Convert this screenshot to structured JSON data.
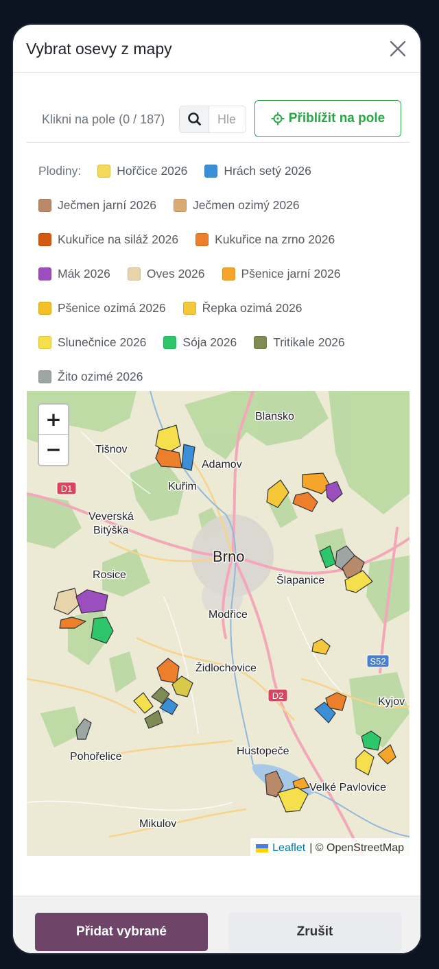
{
  "dialog": {
    "title": "Vybrat osevy z mapy",
    "close_icon": "close-icon"
  },
  "toolbar": {
    "hint": "Klikni na pole (0 / 187)",
    "search_placeholder": "Hle",
    "search_icon": "search-icon",
    "zoom_fields_label": "Přiblížit na pole",
    "zoom_fields_icon": "crosshair-icon"
  },
  "legend": {
    "label": "Plodiny:",
    "rows": [
      [
        {
          "name": "Hořčice 2026",
          "color": "#f5d75a"
        },
        {
          "name": "Hrách setý 2026",
          "color": "#3a8fd6"
        }
      ],
      [
        {
          "name": "Ječmen jarní 2026",
          "color": "#b98a6a"
        },
        {
          "name": "Ječmen ozimý 2026",
          "color": "#d9ab72"
        }
      ],
      [
        {
          "name": "Kukuřice na siláž 2026",
          "color": "#d35a12"
        },
        {
          "name": "Kukuřice na zrno 2026",
          "color": "#ec7f2c"
        }
      ],
      [
        {
          "name": "Mák 2026",
          "color": "#9b4ebd"
        },
        {
          "name": "Oves 2026",
          "color": "#e8d4ab"
        },
        {
          "name": "Pšenice jarní 2026",
          "color": "#f5a529"
        }
      ],
      [
        {
          "name": "Pšenice ozimá 2026",
          "color": "#f2c026"
        },
        {
          "name": "Řepka ozimá 2026",
          "color": "#f5c83a"
        }
      ],
      [
        {
          "name": "Slunečnice 2026",
          "color": "#f6df4c"
        },
        {
          "name": "Sója 2026",
          "color": "#2ec66a"
        },
        {
          "name": "Tritikale 2026",
          "color": "#7f8b55"
        }
      ],
      [
        {
          "name": "Žito ozimé 2026",
          "color": "#9ea6a4"
        }
      ]
    ]
  },
  "map": {
    "zoom_in": "+",
    "zoom_out": "−",
    "attribution_link": "Leaflet",
    "attribution_text": "| © OpenStreetMap",
    "towns": {
      "blansko": "Blansko",
      "tisnov": "Tišnov",
      "adamov": "Adamov",
      "kurim": "Kuřim",
      "veverska1": "Veverská",
      "veverska2": "Bitýška",
      "brno": "Brno",
      "rosice": "Rosice",
      "slapanice": "Šlapanice",
      "modrice": "Modřice",
      "zidlochovice": "Židlochovice",
      "kyjov": "Kyjov",
      "hustopece": "Hustopeče",
      "pohorelice": "Pohořelice",
      "velke_pavlovice": "Velké Pavlovice",
      "mikulov": "Mikulov"
    },
    "road_labels": {
      "d1": "D1",
      "d2": "D2",
      "s52": "S52"
    }
  },
  "footer": {
    "add_label": "Přidat vybrané",
    "cancel_label": "Zrušit"
  }
}
